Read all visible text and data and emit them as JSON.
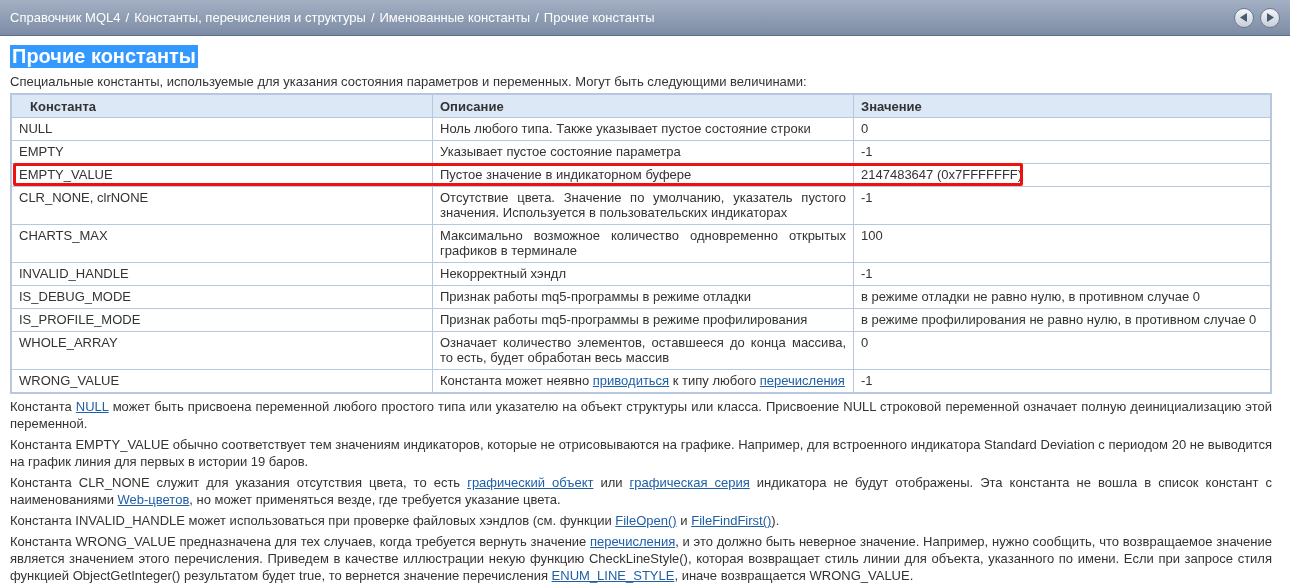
{
  "breadcrumb": {
    "separator": "/",
    "items": [
      "Справочник MQL4",
      "Константы, перечисления и структуры",
      "Именованные константы",
      "Прочие константы"
    ]
  },
  "nav_buttons": [
    {
      "kind": "back"
    },
    {
      "kind": "forward"
    }
  ],
  "title": {
    "text": "Прочие константы",
    "selected": true
  },
  "intro": "Специальные константы, используемые для указания состояния параметров и переменных. Могут быть следующими величинами:",
  "table": {
    "columns": [
      "Константа",
      "Описание",
      "Значение"
    ],
    "rows": [
      {
        "constant": "NULL",
        "description": [
          "Ноль любого типа. Также указывает пустое состояние строки"
        ],
        "value": "0",
        "highlighted": false
      },
      {
        "constant": "EMPTY",
        "description": [
          "Указывает пустое состояние параметра"
        ],
        "value": "-1",
        "highlighted": false
      },
      {
        "constant": "EMPTY_VALUE",
        "description": [
          "Пустое значение в индикаторном буфере"
        ],
        "value": "2147483647 (0x7FFFFFFF)",
        "highlighted": true
      },
      {
        "constant": "CLR_NONE, clrNONE",
        "description": [
          "Отсутствие цвета. Значение по умолчанию, указатель пустого значения. Используется в пользовательских индикаторах"
        ],
        "value": "-1",
        "highlighted": false
      },
      {
        "constant": "CHARTS_MAX",
        "description": [
          "Максимально возможное количество одновременно открытых графиков в терминале"
        ],
        "value": "100",
        "highlighted": false
      },
      {
        "constant": "INVALID_HANDLE",
        "description": [
          "Некорректный хэндл"
        ],
        "value": "-1",
        "highlighted": false
      },
      {
        "constant": "IS_DEBUG_MODE",
        "description": [
          "Признак работы mq5-программы в режиме отладки"
        ],
        "value": "в режиме отладки не равно нулю, в противном случае 0",
        "highlighted": false
      },
      {
        "constant": "IS_PROFILE_MODE",
        "description": [
          "Признак работы mq5-программы в режиме профилирования"
        ],
        "value": "в режиме профилирования не равно нулю, в противном случае 0",
        "highlighted": false
      },
      {
        "constant": "WHOLE_ARRAY",
        "description": [
          "Означает количество элементов, оставшееся до конца массива, то есть, будет обработан весь массив"
        ],
        "value": "0",
        "highlighted": false
      },
      {
        "constant": "WRONG_VALUE",
        "description": [
          "Константа может неявно ",
          {
            "link": "приводиться"
          },
          " к типу любого ",
          {
            "link": "перечисления"
          }
        ],
        "value": "-1",
        "highlighted": false
      }
    ]
  },
  "paragraphs": [
    [
      "Константа ",
      {
        "link": "NULL"
      },
      " может быть присвоена переменной любого простого типа или указателю на объект структуры или класса. Присвоение NULL строковой переменной означает полную деинициализацию этой переменной."
    ],
    [
      "Константа EMPTY_VALUE обычно соответствует тем значениям индикаторов, которые не отрисовываются на графике. Например, для встроенного индикатора Standard Deviation с периодом 20 не выводится на график линия для первых в истории 19 баров."
    ],
    [
      "Константа CLR_NONE служит для указания отсутствия цвета, то есть ",
      {
        "link": "графический объект"
      },
      " или ",
      {
        "link": "графическая серия"
      },
      " индикатора не будут отображены. Эта константа не вошла в список констант с наименованиями ",
      {
        "link": "Web-цветов"
      },
      ", но может применяться везде, где требуется указание цвета."
    ],
    [
      "Константа INVALID_HANDLE может использоваться при проверке файловых хэндлов (см. функции ",
      {
        "link": "FileOpen()"
      },
      " и ",
      {
        "link": "FileFindFirst()"
      },
      ")."
    ],
    [
      "Константа WRONG_VALUE предназначена для тех случаев, когда требуется вернуть значение ",
      {
        "link": "перечисления"
      },
      ", и это должно быть неверное значение. Например, нужно сообщить, что возвращаемое значение является значением этого перечисления. Приведем в качестве иллюстрации некую функцию CheckLineStyle(), которая возвращает стиль линии для объекта, указанного по имени. Если при запросе стиля функцией ObjectGetInteger() результатом будет true, то вернется значение перечисления ",
      {
        "link": "ENUM_LINE_STYLE"
      },
      ", иначе возвращается WRONG_VALUE."
    ]
  ]
}
